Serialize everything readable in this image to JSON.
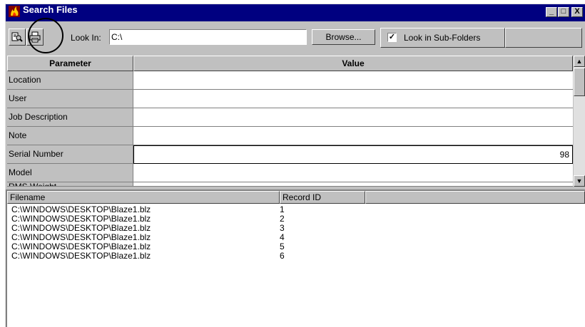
{
  "window": {
    "title": "Search Files",
    "controls": [
      "_",
      "□",
      "X"
    ]
  },
  "toolbar": {
    "look_in_label": "Look In:",
    "look_in_value": "C:\\",
    "browse_label": "Browse...",
    "subfolders_label": "Look in Sub-Folders",
    "subfolders_checked": true
  },
  "grid": {
    "headers": [
      "Parameter",
      "Value"
    ],
    "rows": [
      {
        "param": "Location",
        "value": ""
      },
      {
        "param": "User",
        "value": ""
      },
      {
        "param": "Job Description",
        "value": ""
      },
      {
        "param": "Note",
        "value": ""
      },
      {
        "param": "Serial Number",
        "value": "98"
      },
      {
        "param": "Model",
        "value": ""
      },
      {
        "param": "RMS Weight",
        "value": ""
      }
    ]
  },
  "results": {
    "headers": [
      "Filename",
      "Record ID"
    ],
    "rows": [
      {
        "filename": "C:\\WINDOWS\\DESKTOP\\Blaze1.blz",
        "record_id": "1"
      },
      {
        "filename": "C:\\WINDOWS\\DESKTOP\\Blaze1.blz",
        "record_id": "2"
      },
      {
        "filename": "C:\\WINDOWS\\DESKTOP\\Blaze1.blz",
        "record_id": "3"
      },
      {
        "filename": "C:\\WINDOWS\\DESKTOP\\Blaze1.blz",
        "record_id": "4"
      },
      {
        "filename": "C:\\WINDOWS\\DESKTOP\\Blaze1.blz",
        "record_id": "5"
      },
      {
        "filename": "C:\\WINDOWS\\DESKTOP\\Blaze1.blz",
        "record_id": "6"
      }
    ]
  },
  "colors": {
    "titlebar": "#000080",
    "face": "#c0c0c0"
  }
}
